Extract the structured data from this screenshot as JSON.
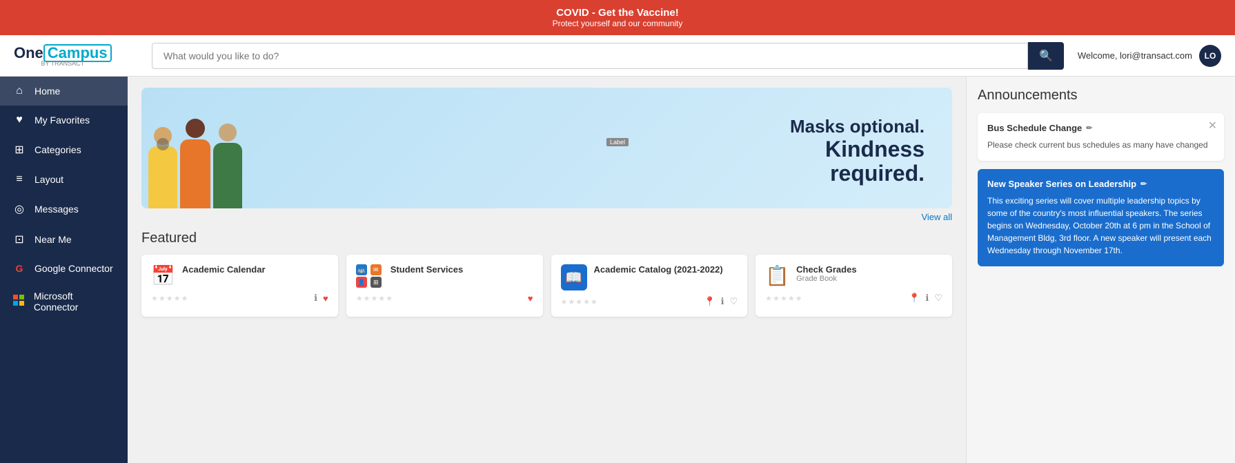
{
  "banner": {
    "title": "COVID - Get the Vaccine!",
    "subtitle": "Protect yourself and our community"
  },
  "header": {
    "logo_one": "One",
    "logo_campus": "Campus",
    "logo_by": "BY TRANSACT",
    "search_placeholder": "What would you like to do?",
    "welcome_text": "Welcome, lori@transact.com",
    "user_initials": "LO"
  },
  "sidebar": {
    "items": [
      {
        "label": "Home",
        "icon": "⌂"
      },
      {
        "label": "My Favorites",
        "icon": "♥"
      },
      {
        "label": "Categories",
        "icon": "⊞"
      },
      {
        "label": "Layout",
        "icon": "≡"
      },
      {
        "label": "Messages",
        "icon": "◎"
      },
      {
        "label": "Near Me",
        "icon": "⊡"
      },
      {
        "label": "Google Connector",
        "icon": "G"
      },
      {
        "label": "Microsoft Connector",
        "icon": "⊟"
      }
    ]
  },
  "carousel": {
    "text_line1": "Masks optional.",
    "text_line2": "Kindness",
    "text_line3": "required.",
    "view_all": "View all",
    "labeled": "Label"
  },
  "featured": {
    "title": "Featured",
    "cards": [
      {
        "title": "Academic Calendar",
        "subtitle": "",
        "icon_type": "calendar",
        "has_heart": false
      },
      {
        "title": "Student Services",
        "subtitle": "",
        "icon_type": "multi",
        "has_heart": true
      },
      {
        "title": "Academic Catalog (2021-2022)",
        "subtitle": "",
        "icon_type": "book",
        "has_heart": false
      },
      {
        "title": "Check Grades",
        "subtitle": "Grade Book",
        "icon_type": "clipboard",
        "has_heart": false
      }
    ]
  },
  "announcements": {
    "title": "Announcements",
    "cards": [
      {
        "title": "Bus Schedule Change",
        "body": "Please check current bus schedules as many have changed",
        "type": "white",
        "has_close": true
      },
      {
        "title": "New Speaker Series on Leadership",
        "body": "This exciting series will cover multiple leadership topics by some of the country's most influential speakers. The series begins on Wednesday, October 20th at 6 pm in the School of Management Bldg, 3rd floor. A new speaker will present each Wednesday through November 17th.",
        "type": "blue",
        "has_close": false
      }
    ]
  }
}
